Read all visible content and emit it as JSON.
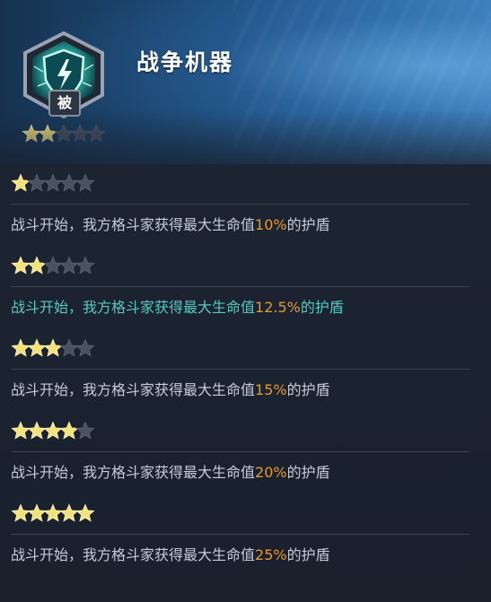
{
  "skill": {
    "name": "战争机器",
    "tag": "被",
    "current_stars": 2,
    "max_stars": 5,
    "icon": "lightning-shield-icon"
  },
  "levels": [
    {
      "stars": 1,
      "prefix": "战斗开始，我方格斗家获得最大生命值",
      "value": "10%",
      "suffix": "的护盾",
      "active": false
    },
    {
      "stars": 2,
      "prefix": "战斗开始，我方格斗家获得最大生命值",
      "value": "12.5%",
      "suffix": "的护盾",
      "active": true
    },
    {
      "stars": 3,
      "prefix": "战斗开始，我方格斗家获得最大生命值",
      "value": "15%",
      "suffix": "的护盾",
      "active": false
    },
    {
      "stars": 4,
      "prefix": "战斗开始，我方格斗家获得最大生命值",
      "value": "20%",
      "suffix": "的护盾",
      "active": false
    },
    {
      "stars": 5,
      "prefix": "战斗开始，我方格斗家获得最大生命值",
      "value": "25%",
      "suffix": "的护盾",
      "active": false
    }
  ],
  "colors": {
    "star_gold": "#f3e27a",
    "star_gray": "#4a5160",
    "active_text": "#55c9c2",
    "value_text": "#e59a2c"
  }
}
